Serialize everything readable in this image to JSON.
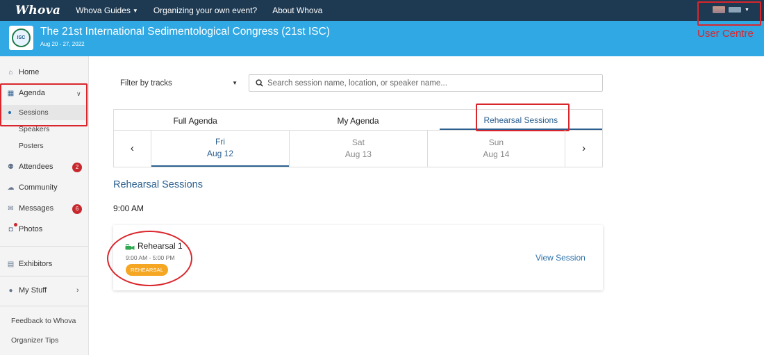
{
  "topbar": {
    "logo": "Whova",
    "nav": [
      {
        "label": "Whova Guides",
        "caret": true
      },
      {
        "label": "Organizing your own event?",
        "caret": false
      },
      {
        "label": "About Whova",
        "caret": false
      }
    ]
  },
  "event": {
    "logo_text": "ISC",
    "title": "The 21st International Sedimentological Congress (21st ISC)",
    "dates": "Aug 20 - 27, 2022"
  },
  "annotations": {
    "user_centre_label": "User Centre",
    "color": "#d9262c"
  },
  "sidebar": {
    "home": "Home",
    "agenda": "Agenda",
    "sessions": "Sessions",
    "speakers": "Speakers",
    "posters": "Posters",
    "attendees": "Attendees",
    "attendees_badge": "2",
    "community": "Community",
    "messages": "Messages",
    "messages_badge": "6",
    "photos": "Photos",
    "exhibitors": "Exhibitors",
    "my_stuff": "My Stuff",
    "feedback": "Feedback to Whova",
    "organizer_tips": "Organizer Tips"
  },
  "filter": {
    "label": "Filter by tracks"
  },
  "search": {
    "placeholder": "Search session name, location, or speaker name..."
  },
  "tabs": [
    {
      "label": "Full Agenda",
      "active": false
    },
    {
      "label": "My Agenda",
      "active": false
    },
    {
      "label": "Rehearsal Sessions",
      "active": true
    }
  ],
  "days": [
    {
      "weekday": "Fri",
      "date": "Aug 12",
      "active": true
    },
    {
      "weekday": "Sat",
      "date": "Aug 13",
      "active": false
    },
    {
      "weekday": "Sun",
      "date": "Aug 14",
      "active": false
    }
  ],
  "main": {
    "section_title": "Rehearsal Sessions",
    "time_label": "9:00 AM"
  },
  "session": {
    "name": "Rehearsal 1",
    "time": "9:00 AM - 5:00 PM",
    "tag": "REHEARSAL",
    "link": "View Session"
  },
  "colors": {
    "topbar": "#1e3a52",
    "event_header": "#2fa8e4",
    "accent": "#2b5f8f",
    "badge": "#c7282e",
    "tag": "#f5a623"
  }
}
